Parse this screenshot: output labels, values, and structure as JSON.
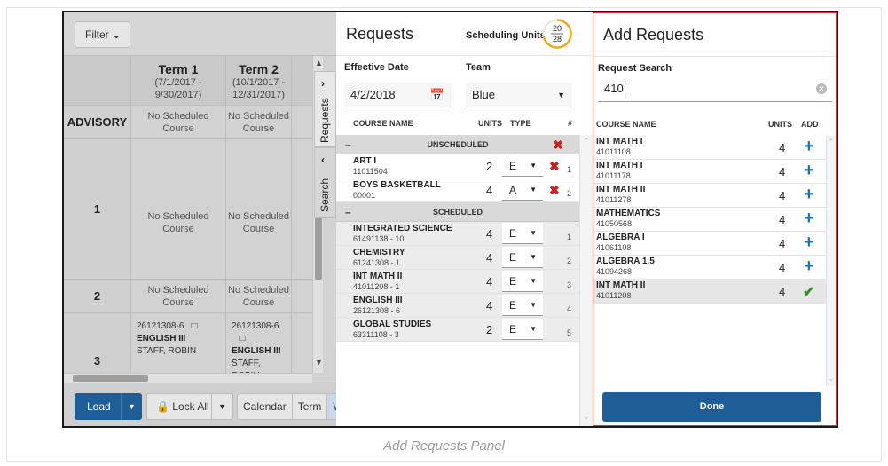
{
  "colors": {
    "accent": "#1e5d96",
    "delete": "#cc1f1f",
    "add": "#1e6fb0",
    "check": "#3c8a2e",
    "highlight_border": "#e43232",
    "gauge": "#f0a81c"
  },
  "schedule": {
    "filter_label": "Filter",
    "columns": [
      {
        "title": "Term 1",
        "dates": "(7/1/2017 -",
        "dates2": "9/30/2017)"
      },
      {
        "title": "Term 2",
        "dates": "(10/1/2017 -",
        "dates2": "12/31/2017)"
      }
    ],
    "periods": [
      "ADVISORY",
      "1",
      "2",
      "3"
    ],
    "no_course": "No Scheduled",
    "no_course2": "Course",
    "section_code": "26121308-6",
    "section_course": "ENGLISH III",
    "section_teacher": "STAFF, ROBIN",
    "tabs": {
      "requests": "Requests",
      "search": "Search"
    },
    "bottom": {
      "load": "Load",
      "lock_all": "Lock All",
      "calendar": "Calendar",
      "term": "Term",
      "wa": "Wa"
    }
  },
  "requests": {
    "title": "Requests",
    "scheduling_units_label": "Scheduling Units:",
    "units_used": "20",
    "units_total": "28",
    "units_fraction": 0.714,
    "effective_date_label": "Effective Date",
    "effective_date": "4/2/2018",
    "team_label": "Team",
    "team": "Blue",
    "headers": {
      "course": "COURSE NAME",
      "units": "UNITS",
      "type": "TYPE",
      "num": "#"
    },
    "unscheduled_label": "UNSCHEDULED",
    "scheduled_label": "SCHEDULED",
    "unscheduled": [
      {
        "name": "ART I",
        "code": "11011504",
        "units": "2",
        "type": "E",
        "num": "1"
      },
      {
        "name": "BOYS BASKETBALL",
        "code": "00001",
        "units": "4",
        "type": "A",
        "num": "2"
      }
    ],
    "scheduled": [
      {
        "name": "INTEGRATED SCIENCE",
        "code": "61491138 - 10",
        "units": "4",
        "type": "E",
        "num": "1"
      },
      {
        "name": "CHEMISTRY",
        "code": "61241308 - 1",
        "units": "4",
        "type": "E",
        "num": "2"
      },
      {
        "name": "INT MATH II",
        "code": "41011208 - 1",
        "units": "4",
        "type": "E",
        "num": "3"
      },
      {
        "name": "ENGLISH III",
        "code": "26121308 - 6",
        "units": "4",
        "type": "E",
        "num": "4"
      },
      {
        "name": "GLOBAL STUDIES",
        "code": "63311108 - 3",
        "units": "2",
        "type": "E",
        "num": "5"
      }
    ]
  },
  "add_requests": {
    "title": "Add Requests",
    "search_label": "Request Search",
    "search_value": "410",
    "headers": {
      "course": "COURSE NAME",
      "units": "UNITS",
      "add": "ADD"
    },
    "results": [
      {
        "name": "INT MATH I",
        "code": "41011108",
        "units": "4",
        "added": false
      },
      {
        "name": "INT MATH I",
        "code": "41011178",
        "units": "4",
        "added": false
      },
      {
        "name": "INT MATH II",
        "code": "41011278",
        "units": "4",
        "added": false
      },
      {
        "name": "MATHEMATICS",
        "code": "41050568",
        "units": "4",
        "added": false
      },
      {
        "name": "ALGEBRA I",
        "code": "41061108",
        "units": "4",
        "added": false
      },
      {
        "name": "ALGEBRA 1.5",
        "code": "41094268",
        "units": "4",
        "added": false
      },
      {
        "name": "INT MATH II",
        "code": "41011208",
        "units": "4",
        "added": true
      }
    ],
    "done_label": "Done"
  },
  "caption": "Add Requests Panel"
}
